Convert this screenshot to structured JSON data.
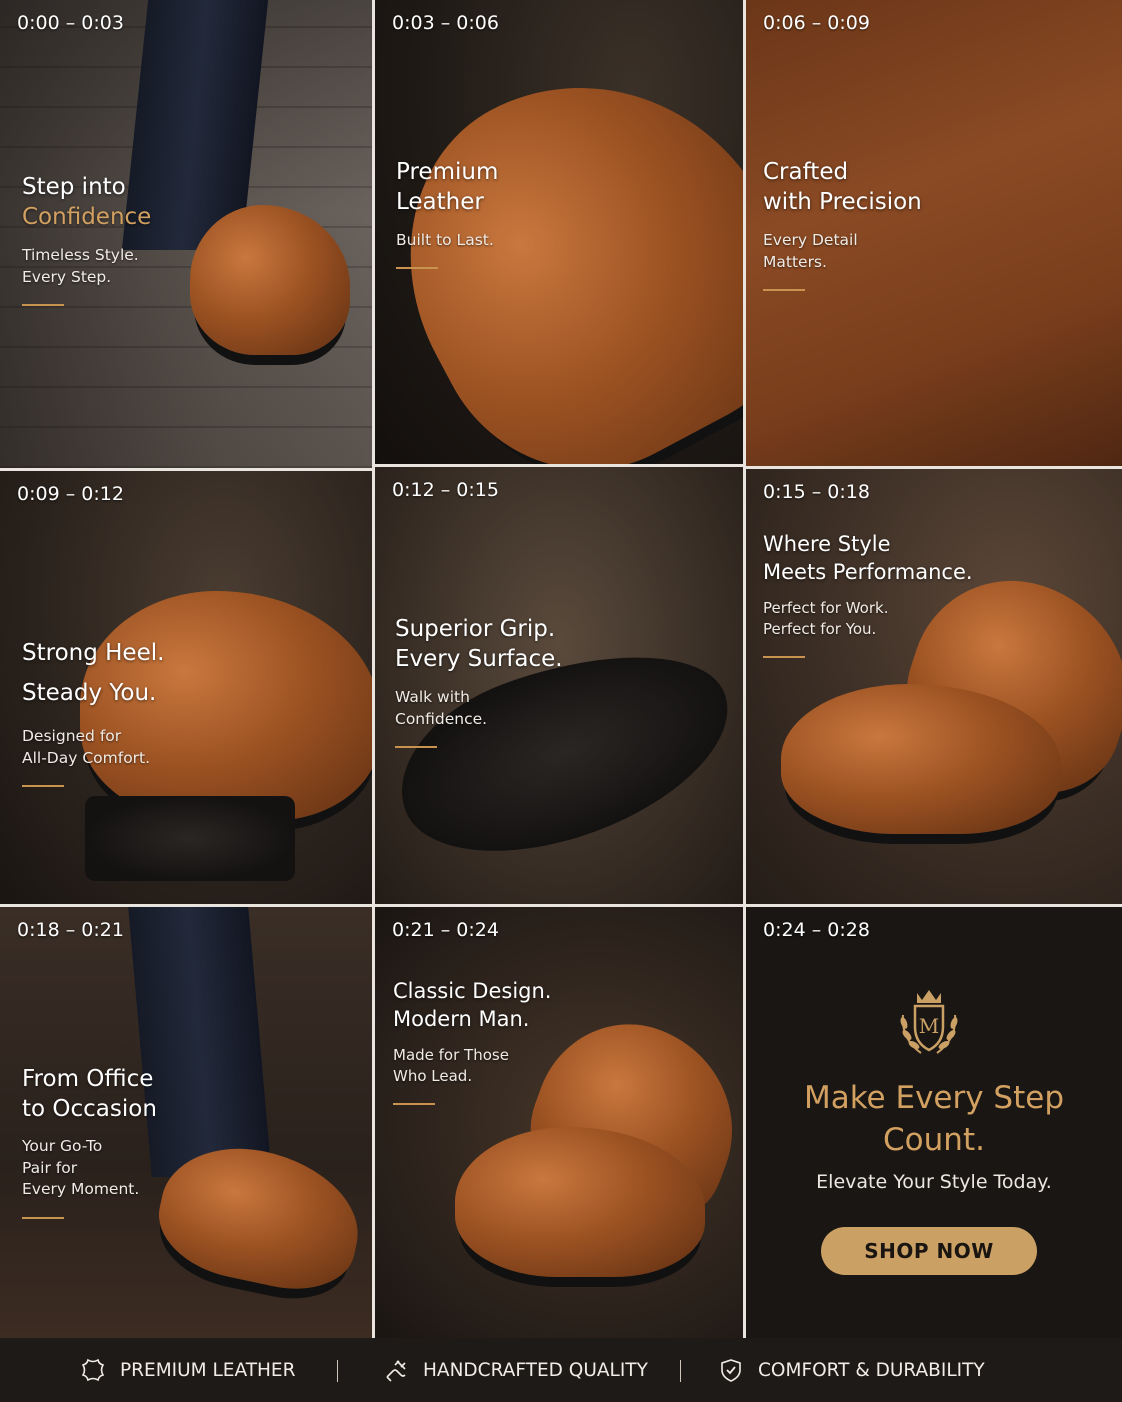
{
  "panels": [
    {
      "time": "0:00 – 0:03",
      "title_l1": "Step into",
      "title_l2": "Confidence",
      "sub_l1": "Timeless Style.",
      "sub_l2": "Every Step."
    },
    {
      "time": "0:03 – 0:06",
      "title_l1": "Premium",
      "title_l2": "Leather",
      "sub_l1": "Built to Last."
    },
    {
      "time": "0:06 – 0:09",
      "title_l1": "Crafted",
      "title_l2": "with Precision",
      "sub_l1": "Every Detail",
      "sub_l2": "Matters."
    },
    {
      "time": "0:09 – 0:12",
      "title_l1": "Strong Heel.",
      "title_l2": "Steady You.",
      "sub_l1": "Designed for",
      "sub_l2": "All-Day Comfort."
    },
    {
      "time": "0:12 – 0:15",
      "title_l1": "Superior Grip.",
      "title_l2": "Every Surface.",
      "sub_l1": "Walk with",
      "sub_l2": "Confidence."
    },
    {
      "time": "0:15 – 0:18",
      "title_l1": "Where Style",
      "title_l2": "Meets Performance.",
      "sub_l1": "Perfect for Work.",
      "sub_l2": "Perfect for You."
    },
    {
      "time": "0:18 – 0:21",
      "title_l1": "From Office",
      "title_l2": "to Occasion",
      "sub_l1": "Your Go-To",
      "sub_l2": "Pair for",
      "sub_l3": "Every Moment."
    },
    {
      "time": "0:21 – 0:24",
      "title_l1": "Classic Design.",
      "title_l2": "Modern Man.",
      "sub_l1": "Made for Those",
      "sub_l2": "Who Lead."
    },
    {
      "time": "0:24 – 0:28",
      "crest_letter": "M",
      "cta_l1": "Make Every Step",
      "cta_l2": "Count.",
      "cta_sub": "Elevate Your Style Today.",
      "button": "SHOP NOW"
    }
  ],
  "footer": {
    "items": [
      {
        "label": "PREMIUM LEATHER",
        "icon": "leather-hide-icon"
      },
      {
        "label": "HANDCRAFTED QUALITY",
        "icon": "handcraft-icon"
      },
      {
        "label": "COMFORT & DURABILITY",
        "icon": "shield-check-icon"
      }
    ],
    "separator": "|"
  },
  "colors": {
    "accent_gold": "#d2a060",
    "button_gold": "#caa064",
    "footer_bg": "#1e1a18"
  }
}
